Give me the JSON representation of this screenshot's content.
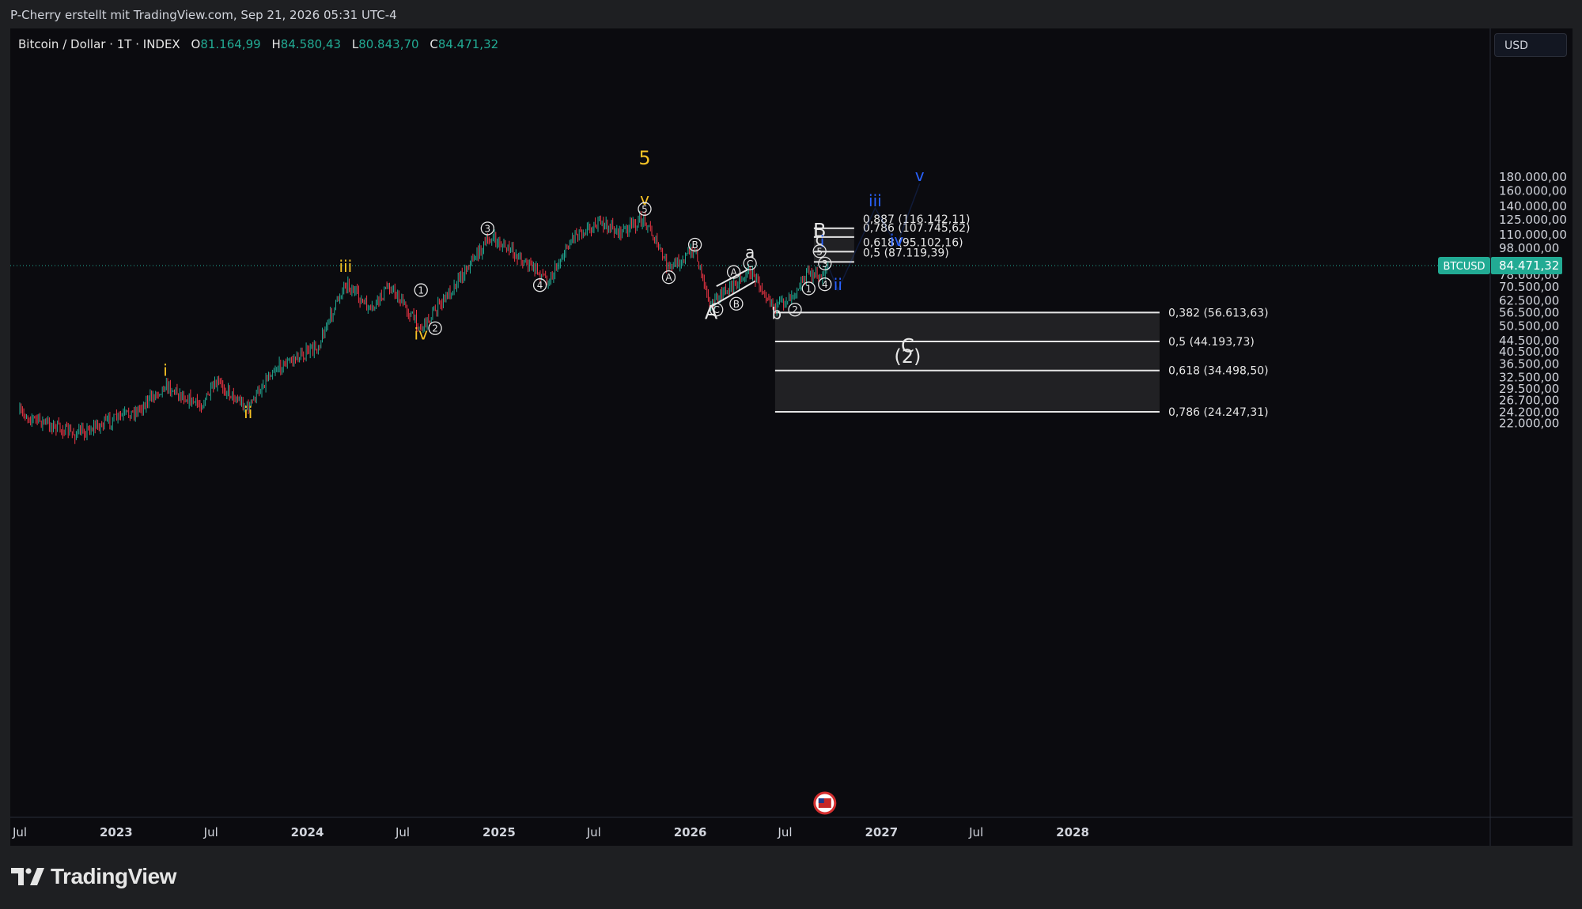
{
  "header": {
    "attribution": "P-Cherry erstellt mit TradingView.com, Sep 21, 2026 05:31 UTC-4"
  },
  "legend": {
    "title": "Bitcoin / Dollar · 1T · INDEX",
    "o_label": "O",
    "o_value": "81.164,99",
    "h_label": "H",
    "h_value": "84.580,43",
    "l_label": "L",
    "l_value": "80.843,70",
    "c_label": "C",
    "c_value": "84.471,32"
  },
  "currency": "USD",
  "price_tag": {
    "symbol": "BTCUSD",
    "value": "84.471,32"
  },
  "brand": "TradingView",
  "colors": {
    "up": "#22ab94",
    "down": "#f23645",
    "yellow": "#f7c325",
    "blue": "#2962ff",
    "white": "#e6e6e6"
  },
  "chart_data": {
    "type": "candlestick",
    "scale": "log",
    "x_axis": {
      "ticks": [
        "Jul",
        "2023",
        "Jul",
        "2024",
        "Jul",
        "2025",
        "Jul",
        "2026",
        "Jul",
        "2027",
        "Jul",
        "2028"
      ]
    },
    "y_axis": {
      "ticks": [
        180000,
        160000,
        140000,
        125000,
        110000,
        98000,
        78000,
        70500,
        62500,
        56500,
        50500,
        44500,
        40500,
        36500,
        32500,
        29500,
        26700,
        24200,
        22000
      ],
      "tick_labels": [
        "180.000,00",
        "160.000,00",
        "140.000,00",
        "125.000,00",
        "110.000,00",
        "98.000,00",
        "78.000,00",
        "70.500,00",
        "62.500,00",
        "56.500,00",
        "50.500,00",
        "44.500,00",
        "40.500,00",
        "36.500,00",
        "32.500,00",
        "29.500,00",
        "26.700,00",
        "24.200,00",
        "22.000,00"
      ]
    },
    "current_price": 84471.32,
    "price_path": [
      {
        "date": "2022-07-01",
        "price": 24000
      },
      {
        "date": "2022-10-15",
        "price": 20000
      },
      {
        "date": "2023-02-10",
        "price": 24500
      },
      {
        "date": "2023-04-05",
        "price": 30500
      },
      {
        "date": "2023-06-10",
        "price": 25500
      },
      {
        "date": "2023-07-15",
        "price": 31000
      },
      {
        "date": "2023-09-10",
        "price": 25000
      },
      {
        "date": "2023-10-25",
        "price": 34500
      },
      {
        "date": "2024-01-20",
        "price": 42000
      },
      {
        "date": "2024-03-14",
        "price": 73500
      },
      {
        "date": "2024-05-01",
        "price": 57000
      },
      {
        "date": "2024-06-05",
        "price": 71500
      },
      {
        "date": "2024-08-05",
        "price": 49500
      },
      {
        "date": "2024-09-20",
        "price": 64000
      },
      {
        "date": "2024-11-15",
        "price": 91000
      },
      {
        "date": "2024-12-17",
        "price": 107000
      },
      {
        "date": "2025-02-05",
        "price": 92000
      },
      {
        "date": "2025-04-07",
        "price": 74500
      },
      {
        "date": "2025-05-25",
        "price": 111000
      },
      {
        "date": "2025-07-14",
        "price": 121500
      },
      {
        "date": "2025-08-20",
        "price": 112000
      },
      {
        "date": "2025-10-06",
        "price": 126000
      },
      {
        "date": "2025-11-21",
        "price": 82000
      },
      {
        "date": "2026-01-10",
        "price": 97000
      },
      {
        "date": "2026-02-10",
        "price": 60000
      },
      {
        "date": "2026-03-10",
        "price": 68000
      },
      {
        "date": "2026-04-25",
        "price": 80500
      },
      {
        "date": "2026-06-15",
        "price": 59000
      },
      {
        "date": "2026-07-15",
        "price": 67000
      },
      {
        "date": "2026-08-15",
        "price": 79500
      },
      {
        "date": "2026-09-05",
        "price": 76000
      },
      {
        "date": "2026-09-21",
        "price": 84471
      }
    ],
    "fibonacci_upper": [
      {
        "label": "0,887 (116.142,11)",
        "price": 116142.11
      },
      {
        "label": "0,786 (107.745,62)",
        "price": 107745.62
      },
      {
        "label": "0,618 (95.102,16)",
        "price": 95102.16
      },
      {
        "label": "0,5 (87.119,39)",
        "price": 87119.39
      }
    ],
    "fibonacci_lower": [
      {
        "label": "0,382 (56.613,63)",
        "price": 56613.63
      },
      {
        "label": "0,5 (44.193,73)",
        "price": 44193.73
      },
      {
        "label": "0,618 (34.498,50)",
        "price": 34498.5
      },
      {
        "label": "0,786 (24.247,31)",
        "price": 24247.31
      }
    ],
    "wave_labels": [
      {
        "text": "i",
        "date": "2023-04-05",
        "price": 33000,
        "color": "yellow",
        "size": "m"
      },
      {
        "text": "ii",
        "date": "2023-09-10",
        "price": 23000,
        "color": "yellow",
        "size": "m"
      },
      {
        "text": "iii",
        "date": "2024-03-14",
        "price": 80000,
        "color": "yellow",
        "size": "m"
      },
      {
        "text": "iv",
        "date": "2024-08-05",
        "price": 45000,
        "color": "yellow",
        "size": "m"
      },
      {
        "text": "v",
        "date": "2025-10-06",
        "price": 142000,
        "color": "yellow",
        "size": "m"
      },
      {
        "text": "5",
        "date": "2025-10-06",
        "price": 200000,
        "color": "yellow",
        "size": "l"
      },
      {
        "text": "A",
        "date": "2026-02-10",
        "price": 53500,
        "color": "white",
        "size": "l"
      },
      {
        "text": "a",
        "date": "2026-04-25",
        "price": 90500,
        "color": "white",
        "size": "m"
      },
      {
        "text": "b",
        "date": "2026-06-15",
        "price": 53500,
        "color": "white",
        "size": "m"
      },
      {
        "text": "B",
        "date": "2026-09-05",
        "price": 108000,
        "color": "white",
        "size": "l"
      },
      {
        "text": "c",
        "date": "2026-09-05",
        "price": 101000,
        "color": "white",
        "size": "m"
      },
      {
        "text": "C",
        "date": "2027-02-20",
        "price": 40300,
        "color": "white",
        "size": "l"
      },
      {
        "text": "(2)",
        "date": "2027-02-20",
        "price": 36800,
        "color": "white",
        "size": "l"
      },
      {
        "text": "i",
        "date": "2026-09-10",
        "price": 99000,
        "color": "blue",
        "size": "m"
      },
      {
        "text": "ii",
        "date": "2026-10-10",
        "price": 68500,
        "color": "blue",
        "size": "m"
      },
      {
        "text": "iii",
        "date": "2026-12-20",
        "price": 140000,
        "color": "blue",
        "size": "m"
      },
      {
        "text": "iv",
        "date": "2027-01-30",
        "price": 100000,
        "color": "blue",
        "size": "m"
      },
      {
        "text": "v",
        "date": "2027-03-15",
        "price": 174000,
        "color": "blue",
        "size": "m"
      }
    ],
    "circle_labels": [
      {
        "text": "1",
        "date": "2024-08-05",
        "price": 68500
      },
      {
        "text": "2",
        "date": "2024-09-01",
        "price": 49500
      },
      {
        "text": "3",
        "date": "2024-12-10",
        "price": 116000
      },
      {
        "text": "4",
        "date": "2025-03-20",
        "price": 71500
      },
      {
        "text": "5",
        "date": "2025-10-06",
        "price": 137000
      },
      {
        "text": "A",
        "date": "2025-11-21",
        "price": 76500
      },
      {
        "text": "B",
        "date": "2026-01-10",
        "price": 101000
      },
      {
        "text": "C",
        "date": "2026-04-25",
        "price": 86000
      },
      {
        "text": "A",
        "date": "2026-03-25",
        "price": 80000
      },
      {
        "text": "B",
        "date": "2026-03-30",
        "price": 61000
      },
      {
        "text": "C",
        "date": "2026-02-20",
        "price": 58000
      },
      {
        "text": "1",
        "date": "2026-08-15",
        "price": 69500
      },
      {
        "text": "2",
        "date": "2026-07-20",
        "price": 58000
      },
      {
        "text": "3",
        "date": "2026-09-00",
        "price": 86000
      },
      {
        "text": "4",
        "date": "2026-09-15",
        "price": 72000
      },
      {
        "text": "5",
        "date": "2026-09-05",
        "price": 95500
      }
    ]
  }
}
